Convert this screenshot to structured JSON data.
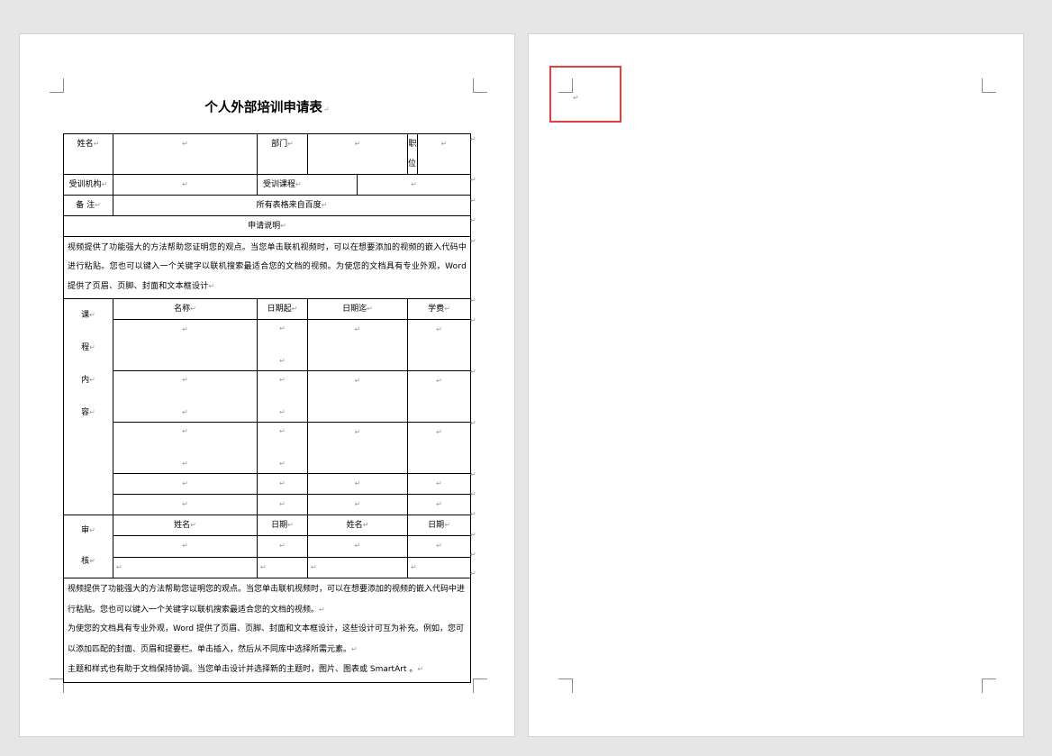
{
  "document": {
    "title": "个人外部培训申请表",
    "paragraph_mark": "↵",
    "form": {
      "row1": {
        "name_label": "姓名",
        "dept_label": "部门",
        "pos_label_top": "职",
        "pos_label_bottom": "位"
      },
      "row2": {
        "org_label": "受训机构",
        "course_label": "受训课程"
      },
      "row3": {
        "remark_label": "备 注",
        "remark_value": "所有表格来自百度"
      },
      "row4": {
        "section_title": "申请说明"
      },
      "row5": {
        "paragraph": "视频提供了功能强大的方法帮助您证明您的观点。当您单击联机视频时，可以在想要添加的视频的嵌入代码中进行粘贴。您也可以键入一个关键字以联机搜索最适合您的文档的视频。为使您的文档具有专业外观，Word 提供了页眉、页脚、封面和文本框设计"
      },
      "course": {
        "side_chars": [
          "课",
          "程",
          "内",
          "容"
        ],
        "headers": [
          "名称",
          "日期起",
          "日期迄",
          "学费"
        ]
      },
      "approval": {
        "side_chars": [
          "审",
          "核"
        ],
        "headers": [
          "姓名",
          "日期",
          "姓名",
          "日期"
        ]
      },
      "footer_lines": [
        "视频提供了功能强大的方法帮助您证明您的观点。当您单击联机视频时，可以在想要添加的视频的嵌入代码中进行粘贴。您也可以键入一个关键字以联机搜索最适合您的文档的视频。",
        "为使您的文档具有专业外观，Word 提供了页眉、页脚、封面和文本框设计，这些设计可互为补充。例如，您可以添加匹配的封面、页眉和提要栏。单击插入，然后从不同库中选择所需元素。",
        "主题和样式也有助于文档保持协调。当您单击设计并选择新的主题时，图片、图表或 SmartArt 。"
      ]
    }
  },
  "colors": {
    "highlight": "#e04040",
    "page": "#ffffff",
    "background": "#e6e6e6"
  }
}
